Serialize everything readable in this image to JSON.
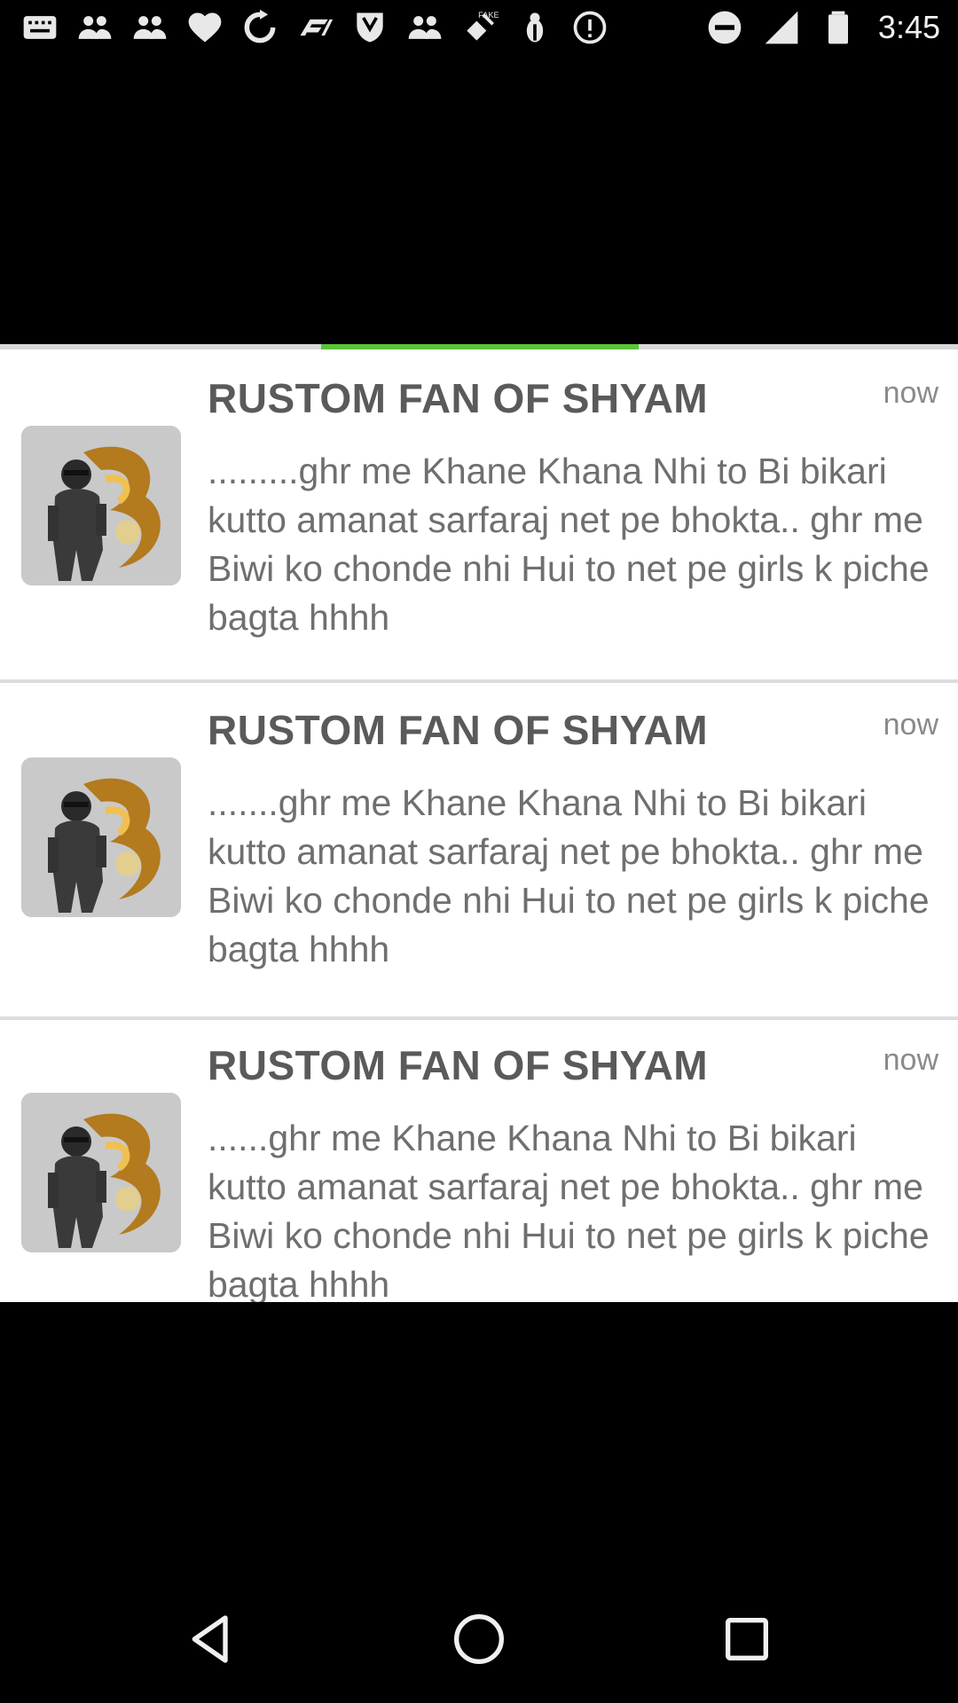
{
  "status_bar": {
    "time": "3:45",
    "left_icons": [
      "messages-icon",
      "people-icon",
      "people-icon",
      "heart-icon",
      "refresh-icon",
      "f1-icon",
      "shield-icon",
      "people-icon",
      "satellite-fake-icon",
      "bug-icon",
      "info-circle-icon"
    ],
    "right_icons": [
      "do-not-disturb-icon",
      "signal-icon",
      "battery-icon"
    ],
    "fake_label": "FAKE"
  },
  "notifications": [
    {
      "title": "RUSTOM FAN OF SHYAM",
      "time": "now",
      "body": ".........ghr me Khane Khana Nhi to Bi bikari kutto amanat sarfaraj net pe bhokta.. ghr me Biwi ko chonde nhi Hui to net pe girls k piche bagta hhhh"
    },
    {
      "title": "RUSTOM FAN OF SHYAM",
      "time": "now",
      "body": ".......ghr me Khane Khana Nhi to Bi bikari kutto amanat sarfaraj net pe bhokta.. ghr me Biwi ko chonde nhi Hui to net pe girls k piche bagta hhhh"
    },
    {
      "title": "RUSTOM FAN OF SHYAM",
      "time": "now",
      "body": "......ghr me Khane Khana Nhi to Bi bikari kutto amanat sarfaraj net pe bhokta.. ghr me Biwi ko chonde nhi Hui to net pe girls k piche bagta hhhh"
    }
  ],
  "colors": {
    "accent": "#5cc43a",
    "title_text": "#5a5a5a",
    "body_text": "#6f6f6f"
  },
  "nav_bar": {
    "buttons": [
      "back-icon",
      "home-icon",
      "recents-icon"
    ]
  }
}
